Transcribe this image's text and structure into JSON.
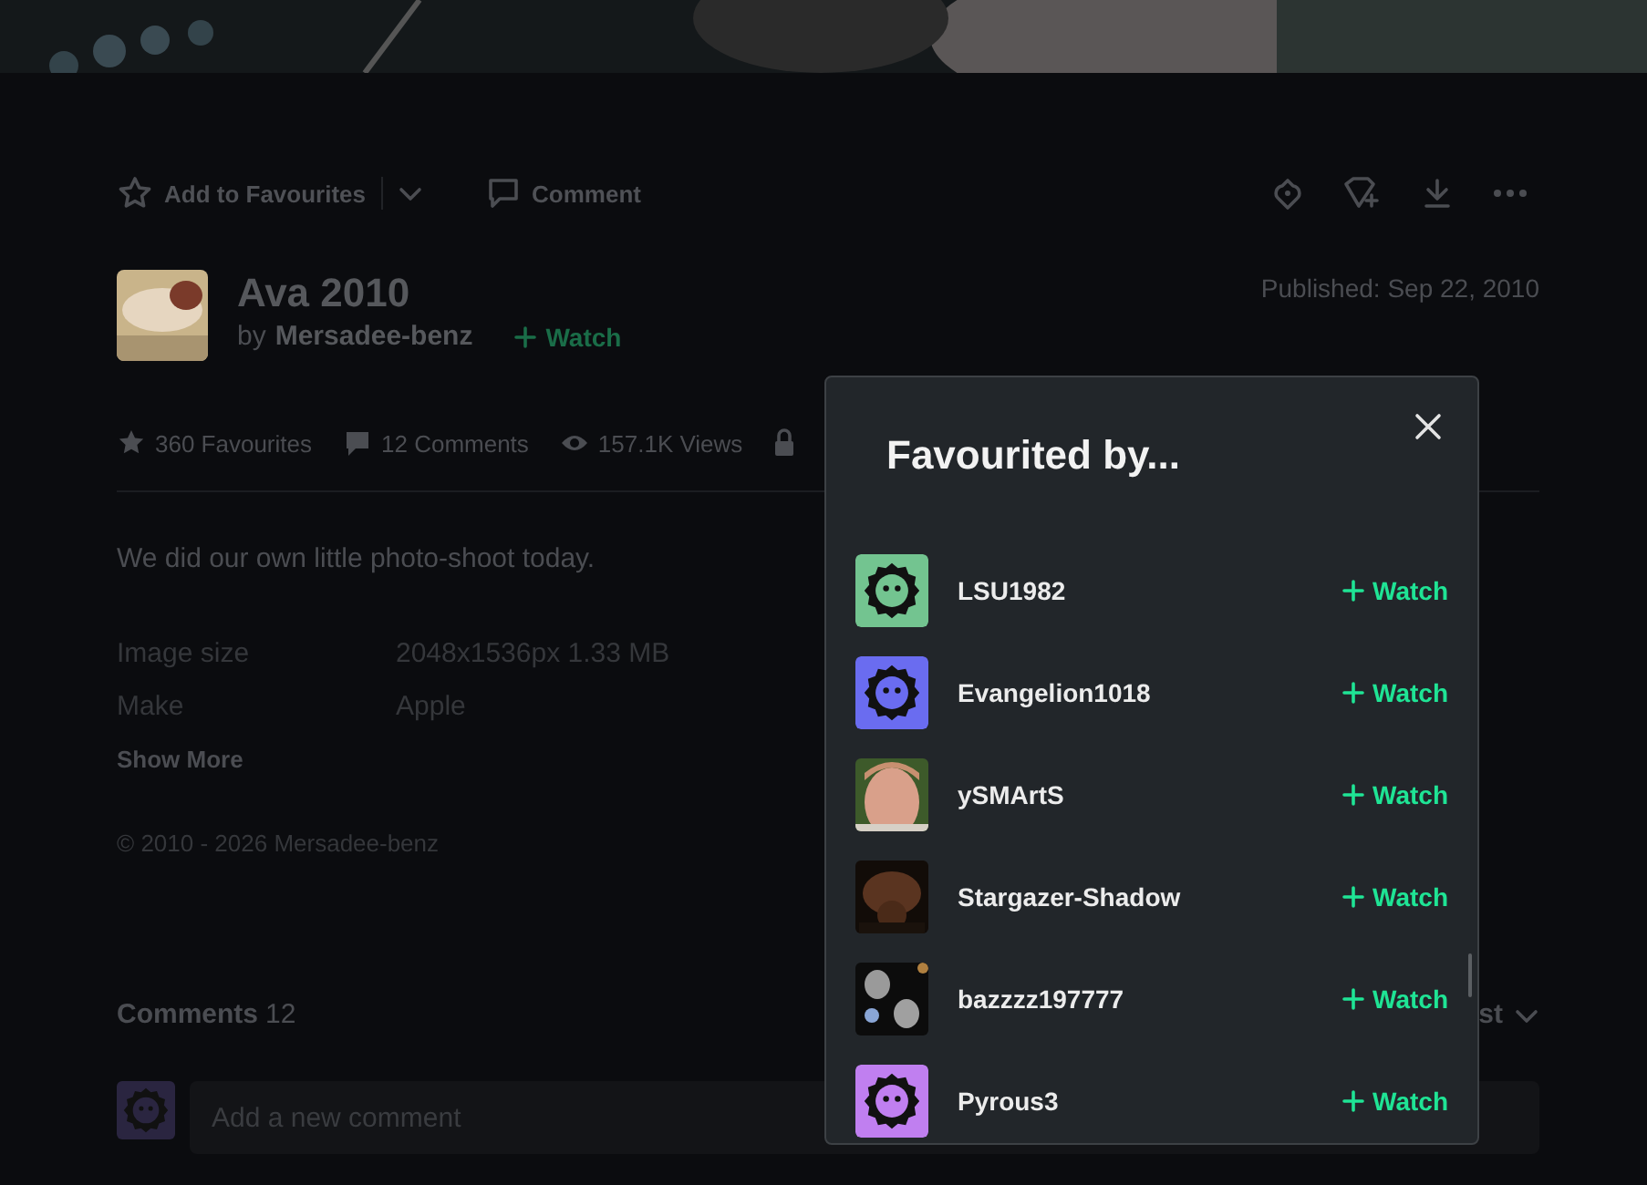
{
  "actions": {
    "favourite": "Add to Favourites",
    "comment": "Comment"
  },
  "deviation": {
    "title": "Ava 2010",
    "by": "by",
    "author": "Mersadee-benz",
    "watch": "Watch",
    "published": "Published: Sep 22, 2010"
  },
  "stats": {
    "favourites": "360 Favourites",
    "comments": "12 Comments",
    "views": "157.1K Views"
  },
  "description": "We did our own little photo-shoot today.",
  "details": [
    {
      "label": "Image size",
      "value": "2048x1536px 1.33 MB"
    },
    {
      "label": "Make",
      "value": "Apple"
    }
  ],
  "show_more": "Show More",
  "copyright": "© 2010 - 2026 Mersadee-benz",
  "comments": {
    "heading": "Comments",
    "count": "12",
    "sort": "st",
    "placeholder": "Add a new comment"
  },
  "modal": {
    "title": "Favourited by...",
    "users": [
      {
        "name": "LSU1982",
        "watch": "Watch",
        "avatar": {
          "kind": "default",
          "color": "#73c490"
        }
      },
      {
        "name": "Evangelion1018",
        "watch": "Watch",
        "avatar": {
          "kind": "default",
          "color": "#6a6cf0"
        }
      },
      {
        "name": "ySMArtS",
        "watch": "Watch"
      },
      {
        "name": "Stargazer-Shadow",
        "watch": "Watch"
      },
      {
        "name": "bazzzz197777",
        "watch": "Watch"
      },
      {
        "name": "Pyrous3",
        "watch": "Watch",
        "avatar": {
          "kind": "default",
          "color": "#c07ff0"
        }
      }
    ]
  }
}
